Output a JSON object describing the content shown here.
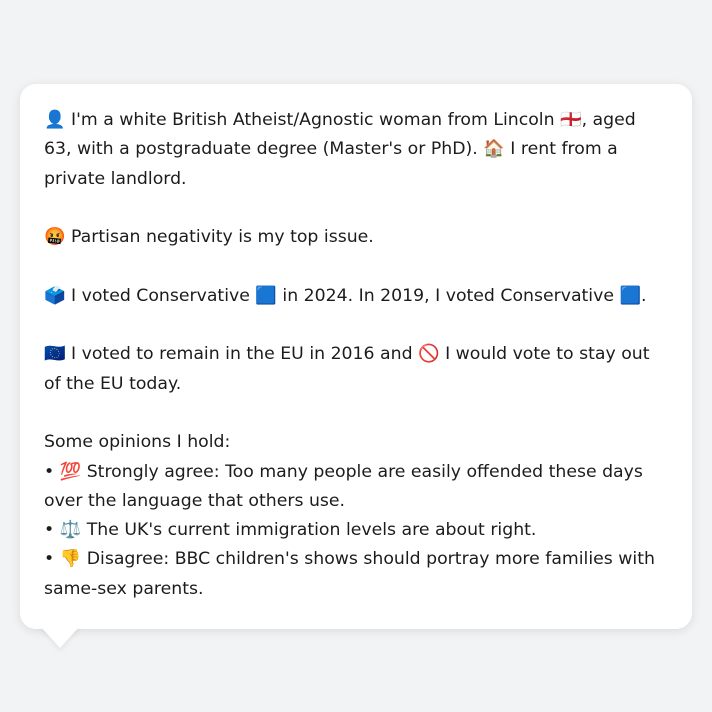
{
  "profile": {
    "intro_icon": "👤",
    "intro_text_a": " I'm a white British Atheist/Agnostic woman from Lincoln ",
    "flag_icon": "🏴󠁧󠁢󠁥󠁮󠁧󠁿",
    "intro_text_b": ", aged 63, with a postgraduate degree (Master's or PhD). ",
    "house_icon": "🏠",
    "intro_text_c": " I rent from a private landlord."
  },
  "top_issue": {
    "icon": "🤬",
    "text": " Partisan negativity is my top issue."
  },
  "voting": {
    "ballot_icon": "🗳️",
    "text_a": " I voted Conservative ",
    "party_icon_1": "🟦",
    "text_b": " in 2024. In 2019, I voted Conservative ",
    "party_icon_2": "🟦",
    "text_c": "."
  },
  "eu": {
    "eu_icon": "🇪🇺",
    "text_a": " I voted to remain in the EU in 2016 and ",
    "no_icon": "🚫",
    "text_b": " I would vote to stay out of the EU today."
  },
  "opinions": {
    "heading": "Some opinions I hold:",
    "items": [
      {
        "bullet": "• ",
        "icon": "💯",
        "text": " Strongly agree: Too many people are easily offended these days over the language that others use."
      },
      {
        "bullet": "• ",
        "icon": "⚖️",
        "text": " The UK's current immigration levels are about right."
      },
      {
        "bullet": "• ",
        "icon": "👎",
        "text": " Disagree: BBC children's shows should portray more families with same-sex parents."
      }
    ]
  }
}
